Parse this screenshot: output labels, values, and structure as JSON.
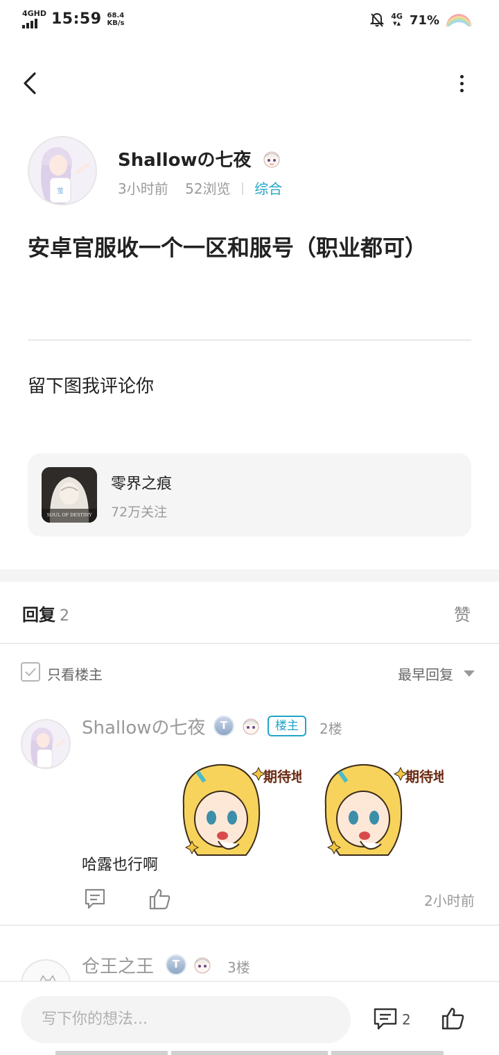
{
  "status_bar": {
    "network": "4GHD",
    "time": "15:59",
    "speed_value": "68.4",
    "speed_unit": "KB/s",
    "cellular": "4G",
    "battery": "71%"
  },
  "nav": {
    "back_icon": "chevron-left-icon",
    "more_icon": "more-vertical-icon"
  },
  "post": {
    "author": "Shallowの七夜",
    "time_ago": "3小时前",
    "views": "52浏览",
    "category": "综合",
    "title": "安卓官服收一个一区和服号（职业都可）",
    "body": "留下图我评论你"
  },
  "game": {
    "name": "零界之痕",
    "followers": "72万关注",
    "icon_text": "SOUL OF DESTINY"
  },
  "replies": {
    "title": "回复",
    "count": "2",
    "like_label": "赞",
    "filter_label": "只看楼主",
    "sort_label": "最早回复",
    "items": [
      {
        "name": "Shallowの七夜",
        "level": "T",
        "owner_tag": "楼主",
        "floor": "2楼",
        "text": "哈露也行啊",
        "sticker_text": "期待地搓手",
        "time": "2小时前"
      },
      {
        "name": "仓王之王",
        "level": "T",
        "floor": "3楼"
      }
    ]
  },
  "bottom": {
    "placeholder": "写下你的想法...",
    "comment_count": "2"
  },
  "colors": {
    "accent": "#22a5c8",
    "muted": "#999999",
    "card_bg": "#f5f5f5"
  }
}
